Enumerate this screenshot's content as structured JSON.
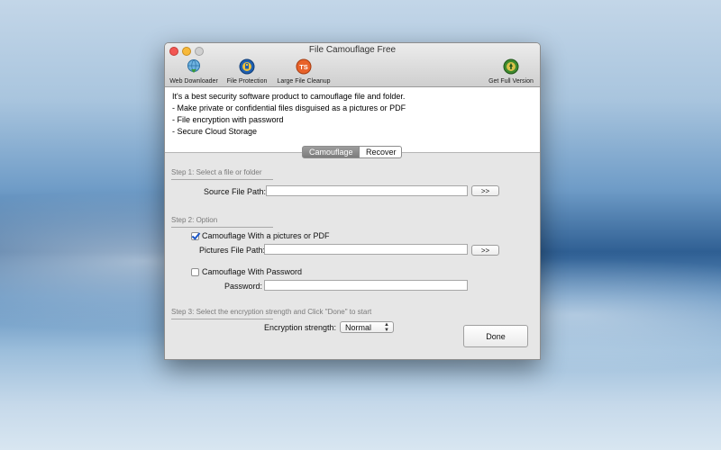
{
  "window": {
    "title": "File Camouflage Free"
  },
  "toolbar": {
    "web_downloader": "Web Downloader",
    "file_protection": "File Protection",
    "large_file_cleanup": "Large File Cleanup",
    "get_full_version": "Get Full Version",
    "large_file_icon_text": "TS"
  },
  "description": {
    "lines": [
      "It's a best security software product to camouflage file and folder.",
      "-  Make private or confidential files disguised as a pictures or PDF",
      "-  File encryption with password",
      "-  Secure Cloud Storage"
    ]
  },
  "tabs": {
    "camouflage": "Camouflage",
    "recover": "Recover"
  },
  "step1": {
    "title": "Step 1:  Select a file or folder",
    "source_label": "Source File Path:",
    "source_value": "",
    "browse_label": ">>"
  },
  "step2": {
    "title": "Step 2:  Option",
    "pictures_checkbox_label": "Camouflage With a pictures or PDF",
    "pictures_checked": true,
    "pictures_path_label": "Pictures File Path:",
    "pictures_path_value": "",
    "pictures_browse_label": ">>",
    "password_checkbox_label": "Camouflage With Password",
    "password_checked": false,
    "password_label": "Password:",
    "password_value": ""
  },
  "step3": {
    "title": "Step 3:  Select the encryption strength and Click \"Done\" to start",
    "strength_label": "Encryption strength:",
    "strength_value": "Normal",
    "done_label": "Done"
  },
  "colors": {
    "close": "#f25753",
    "minimize": "#f7b93a",
    "maximize": "#d0d0d0",
    "tab_active": "#8a8a8a",
    "check": "#1a56c8"
  }
}
